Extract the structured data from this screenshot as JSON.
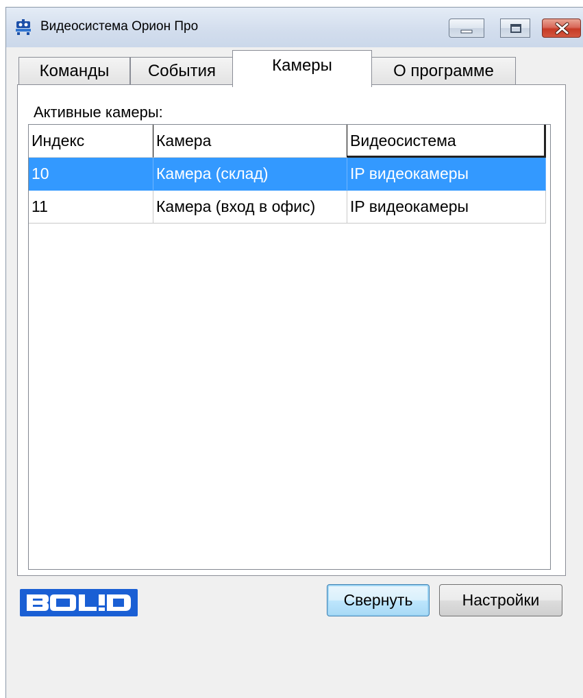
{
  "window": {
    "title": "Видеосистема Орион Про",
    "icon": "camera-app-icon",
    "caption_buttons": [
      "minimize-icon",
      "maximize-icon",
      "close-icon"
    ]
  },
  "tabs": [
    {
      "label": "Команды",
      "active": false
    },
    {
      "label": "События",
      "active": false
    },
    {
      "label": "Камеры",
      "active": true
    },
    {
      "label": "О программе",
      "active": false
    }
  ],
  "cameras_page": {
    "section_label": "Активные камеры:",
    "columns": [
      "Индекс",
      "Камера",
      "Видеосистема"
    ],
    "rows": [
      {
        "index": "10",
        "camera": "Камера (склад)",
        "system": "IP видеокамеры",
        "selected": true
      },
      {
        "index": "11",
        "camera": "Камера (вход в офис)",
        "system": "IP видеокамеры",
        "selected": false
      }
    ]
  },
  "footer": {
    "logo_text": "BOLID",
    "collapse_label": "Свернуть",
    "settings_label": "Настройки"
  },
  "colors": {
    "selection": "#3399ff",
    "logo_blue": "#1a5fd4",
    "close_red": "#c73b26"
  }
}
